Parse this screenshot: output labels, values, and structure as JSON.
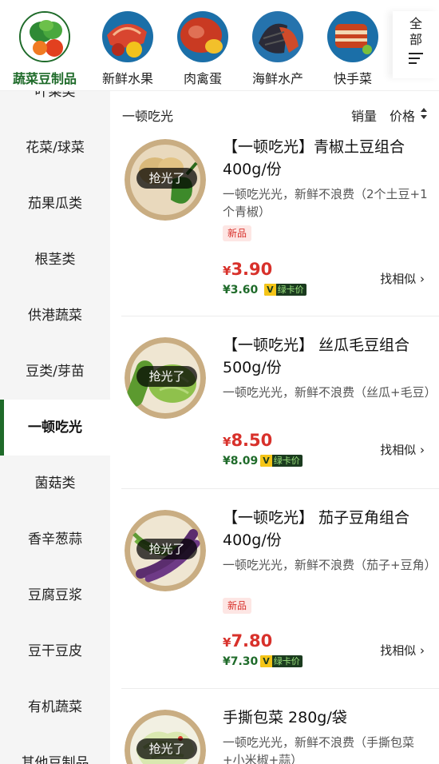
{
  "categories": [
    {
      "label": "蔬菜豆制品",
      "icon": "vegetables-icon",
      "active": true
    },
    {
      "label": "新鲜水果",
      "icon": "fruit-icon",
      "active": false
    },
    {
      "label": "肉禽蛋",
      "icon": "meat-icon",
      "active": false
    },
    {
      "label": "海鲜水产",
      "icon": "seafood-icon",
      "active": false
    },
    {
      "label": "快手菜",
      "icon": "quick-dish-icon",
      "active": false
    }
  ],
  "all_button": {
    "line1": "全",
    "line2": "部"
  },
  "sidebar": {
    "items": [
      {
        "label": "叶菜类"
      },
      {
        "label": "花菜/球菜"
      },
      {
        "label": "茄果瓜类"
      },
      {
        "label": "根茎类"
      },
      {
        "label": "供港蔬菜"
      },
      {
        "label": "豆类/芽苗"
      },
      {
        "label": "一顿吃光",
        "active": true
      },
      {
        "label": "菌菇类"
      },
      {
        "label": "香辛葱蒜"
      },
      {
        "label": "豆腐豆浆"
      },
      {
        "label": "豆干豆皮"
      },
      {
        "label": "有机蔬菜"
      },
      {
        "label": "其他豆制品"
      }
    ]
  },
  "sortbar": {
    "current": "一顿吃光",
    "sales": "销量",
    "price": "价格"
  },
  "products": [
    {
      "name": "【一顿吃光】青椒土豆组合400g/份",
      "desc": "一顿吃光光，新鲜不浪费（2个土豆+1个青椒）",
      "tag": "新品",
      "price": "3.90",
      "card_price": "3.60",
      "soldout": "抢光了",
      "similar": "找相似"
    },
    {
      "name": "【一顿吃光】 丝瓜毛豆组合 500g/份",
      "desc": "一顿吃光光，新鲜不浪费（丝瓜+毛豆）",
      "tag": "",
      "price": "8.50",
      "card_price": "8.09",
      "soldout": "抢光了",
      "similar": "找相似"
    },
    {
      "name": "【一顿吃光】 茄子豆角组合 400g/份",
      "desc": "一顿吃光光，新鲜不浪费（茄子+豆角）",
      "tag": "新品",
      "price": "7.80",
      "card_price": "7.30",
      "soldout": "抢光了",
      "similar": "找相似"
    },
    {
      "name": "手撕包菜 280g/袋",
      "desc": "一顿吃光光，新鲜不浪费（手撕包菜+小米椒+蒜）",
      "tag": "",
      "price": "",
      "card_price": "",
      "soldout": "抢光了",
      "similar": ""
    }
  ],
  "currency_symbol": "¥",
  "card_badge": {
    "v": "V",
    "text": "绿卡价"
  },
  "colors": {
    "brand_green": "#1f6b2a",
    "price_red": "#d8312b",
    "sidebar_bg": "#f5f5f5"
  }
}
